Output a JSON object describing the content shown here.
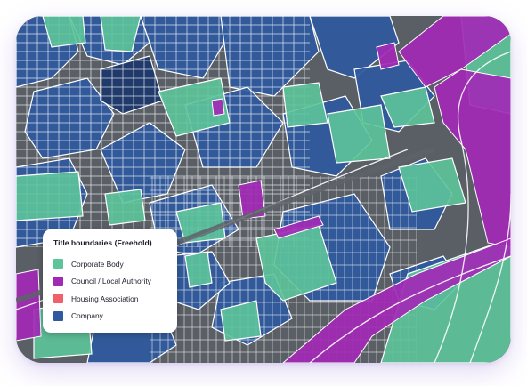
{
  "legend": {
    "title": "Title boundaries (Freehold)",
    "items": [
      {
        "label": "Corporate Body",
        "color": "#5cc49a",
        "icon": "swatch-green"
      },
      {
        "label": "Council / Local Authority",
        "color": "#a229b5",
        "icon": "swatch-purple"
      },
      {
        "label": "Housing Association",
        "color": "#f0606a",
        "icon": "swatch-red"
      },
      {
        "label": "Company",
        "color": "#2f5aa0",
        "icon": "swatch-blue"
      }
    ]
  },
  "colors": {
    "corporate": "#5cc49a",
    "council": "#a229b5",
    "housing": "#f0606a",
    "company": "#2f5aa0",
    "company_dark": "#1f3a6b",
    "road": "#4b5056"
  }
}
